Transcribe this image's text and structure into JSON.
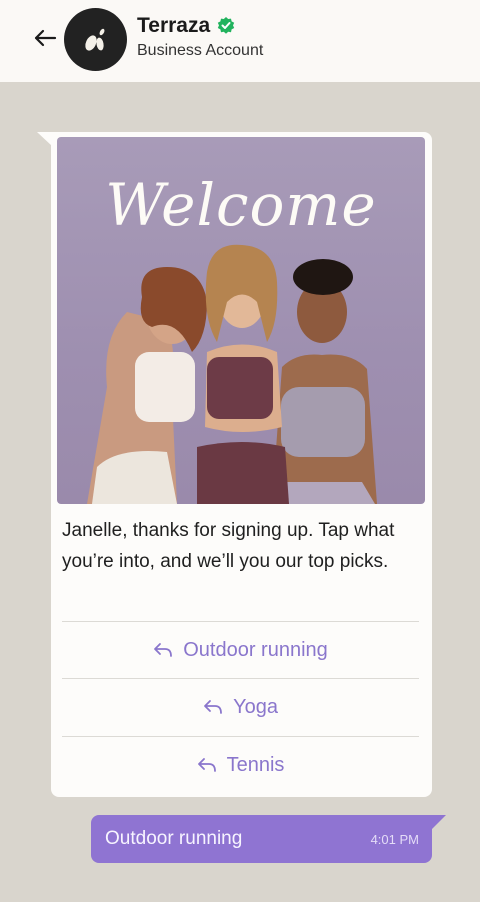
{
  "header": {
    "business_name": "Terraza",
    "subtitle": "Business Account"
  },
  "message": {
    "image_heading": "Welcome",
    "body": "Janelle, thanks for signing up. Tap what you’re into, and we’ll you our top picks.",
    "quick_replies": [
      {
        "label": "Outdoor running"
      },
      {
        "label": "Yoga"
      },
      {
        "label": "Tennis"
      }
    ]
  },
  "sent_message": {
    "text": "Outdoor running",
    "time": "4:01 PM"
  },
  "colors": {
    "accent": "#8f74d2",
    "reply_text": "#8a76cc",
    "verified": "#22b35e",
    "chat_bg": "#d9d5cd"
  }
}
